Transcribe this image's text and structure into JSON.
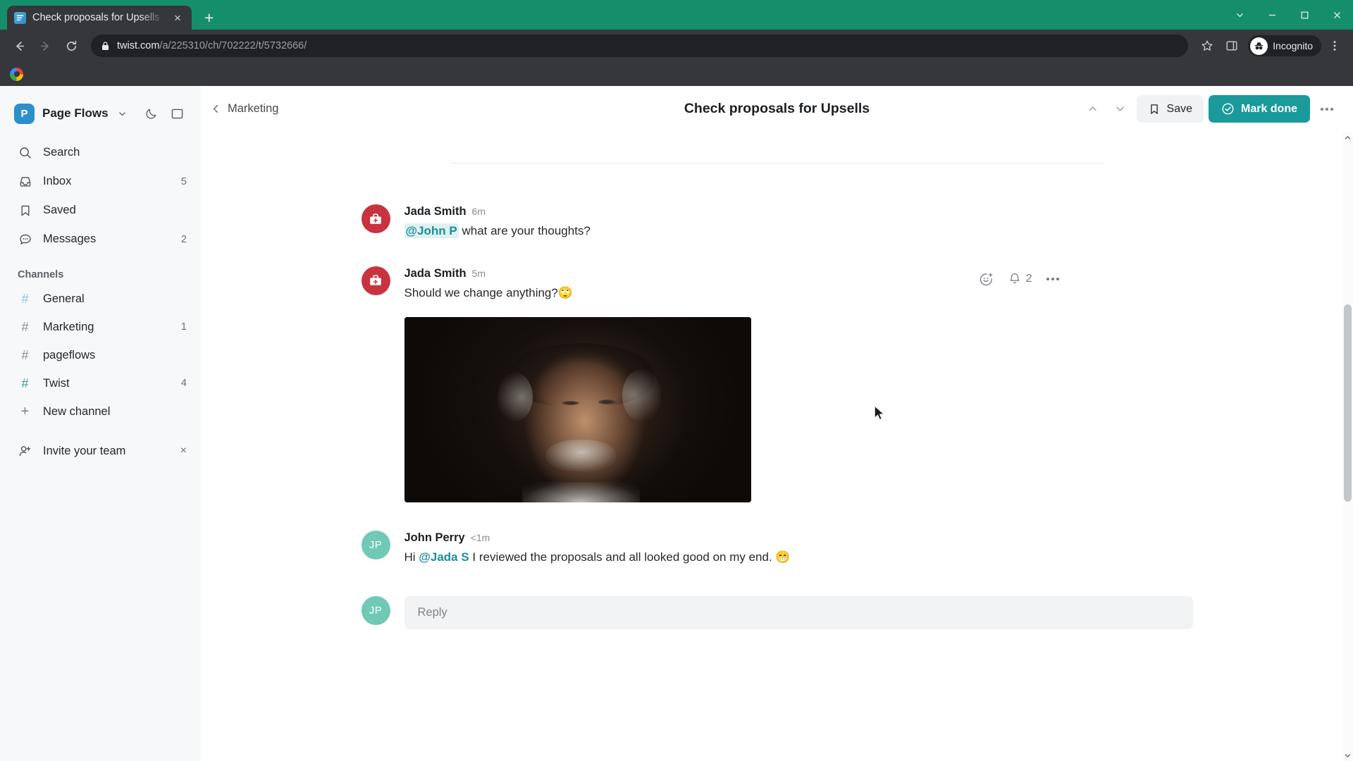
{
  "browser": {
    "tab": {
      "title": "Check proposals for Upsells · Pa",
      "favicon": "twist-favicon-icon",
      "close": "×"
    },
    "new_tab": "+",
    "window_controls": {
      "minimize": "minimize-icon",
      "maximize": "maximize-icon",
      "close": "close-icon",
      "chevron": "chevron-down-icon"
    },
    "nav": {
      "back": "back-arrow-icon",
      "forward": "forward-arrow-icon",
      "reload": "reload-icon"
    },
    "omnibox": {
      "lock": "lock-icon",
      "domain": "twist.com",
      "path": "/a/225310/ch/702222/t/5732666/",
      "star": "star-icon"
    },
    "side_panel": "side-panel-icon",
    "profile": {
      "label": "Incognito",
      "icon": "incognito-icon"
    },
    "menu": "chrome-menu-icon",
    "bookmark": {
      "icon": "google-bookmark-icon"
    },
    "accent": "#158f6b"
  },
  "sidebar": {
    "workspace": {
      "initial": "P",
      "name": "Page Flows",
      "caret": "chevron-down-icon",
      "color": "#2d8fc9"
    },
    "actions": [
      {
        "name": "dark-mode-toggle",
        "icon": "moon-icon"
      },
      {
        "name": "toggle-sidebar",
        "icon": "panel-icon"
      }
    ],
    "nav_items": [
      {
        "label": "Search",
        "icon": "search-icon",
        "count": ""
      },
      {
        "label": "Inbox",
        "icon": "inbox-icon",
        "count": "5"
      },
      {
        "label": "Saved",
        "icon": "bookmark-icon",
        "count": ""
      },
      {
        "label": "Messages",
        "icon": "chat-bubble-icon",
        "count": "2"
      }
    ],
    "channels_title": "Channels",
    "channels": [
      {
        "label": "General",
        "count": "",
        "hash_style": "light"
      },
      {
        "label": "Marketing",
        "count": "1",
        "hash_style": "gray"
      },
      {
        "label": "pageflows",
        "count": "",
        "hash_style": "gray"
      },
      {
        "label": "Twist",
        "count": "4",
        "hash_style": "teal"
      }
    ],
    "new_channel": {
      "label": "New channel",
      "icon": "plus-icon"
    },
    "invite": {
      "label": "Invite your team",
      "icon": "add-person-icon",
      "dismiss": "×"
    }
  },
  "thread": {
    "back_label": "Marketing",
    "back_icon": "chevron-left-icon",
    "title": "Check proposals for Upsells",
    "prev_icon": "chevron-up-icon",
    "next_icon": "chevron-down-icon",
    "save_label": "Save",
    "save_icon": "bookmark-icon",
    "mark_done_label": "Mark done",
    "mark_done_icon": "check-circle-icon",
    "mark_done_color": "#1a9a9a",
    "more_icon": "ellipsis-icon"
  },
  "messages": [
    {
      "author": "Jada Smith",
      "time": "6m",
      "avatar_type": "first-aid-kit",
      "avatar_color": "#c8333f",
      "mention": "@John P",
      "text_after": " what are your thoughts?",
      "has_actions": false
    },
    {
      "author": "Jada Smith",
      "time": "5m",
      "avatar_type": "first-aid-kit",
      "avatar_color": "#c8333f",
      "mention": "",
      "text_after": "Should we change anything?",
      "emoji": "🙄",
      "has_actions": true,
      "actions": {
        "react_icon": "add-reaction-icon",
        "bell_icon": "bell-icon",
        "bell_count": "2",
        "more_icon": "ellipsis-icon"
      },
      "attachment": {
        "name": "video-thumbnail",
        "alt": "Dark portrait of a man"
      }
    },
    {
      "author": "John Perry",
      "time": "<1m",
      "avatar_type": "initials",
      "avatar_initials": "JP",
      "avatar_color": "#6fc9b5",
      "text_before": "Hi ",
      "mention": "@Jada S",
      "text_after": " I reviewed the proposals and all looked good on my end. ",
      "emoji": "😁",
      "has_actions": false
    }
  ],
  "reply": {
    "avatar_initials": "JP",
    "avatar_color": "#6fc9b5",
    "placeholder": "Reply"
  }
}
